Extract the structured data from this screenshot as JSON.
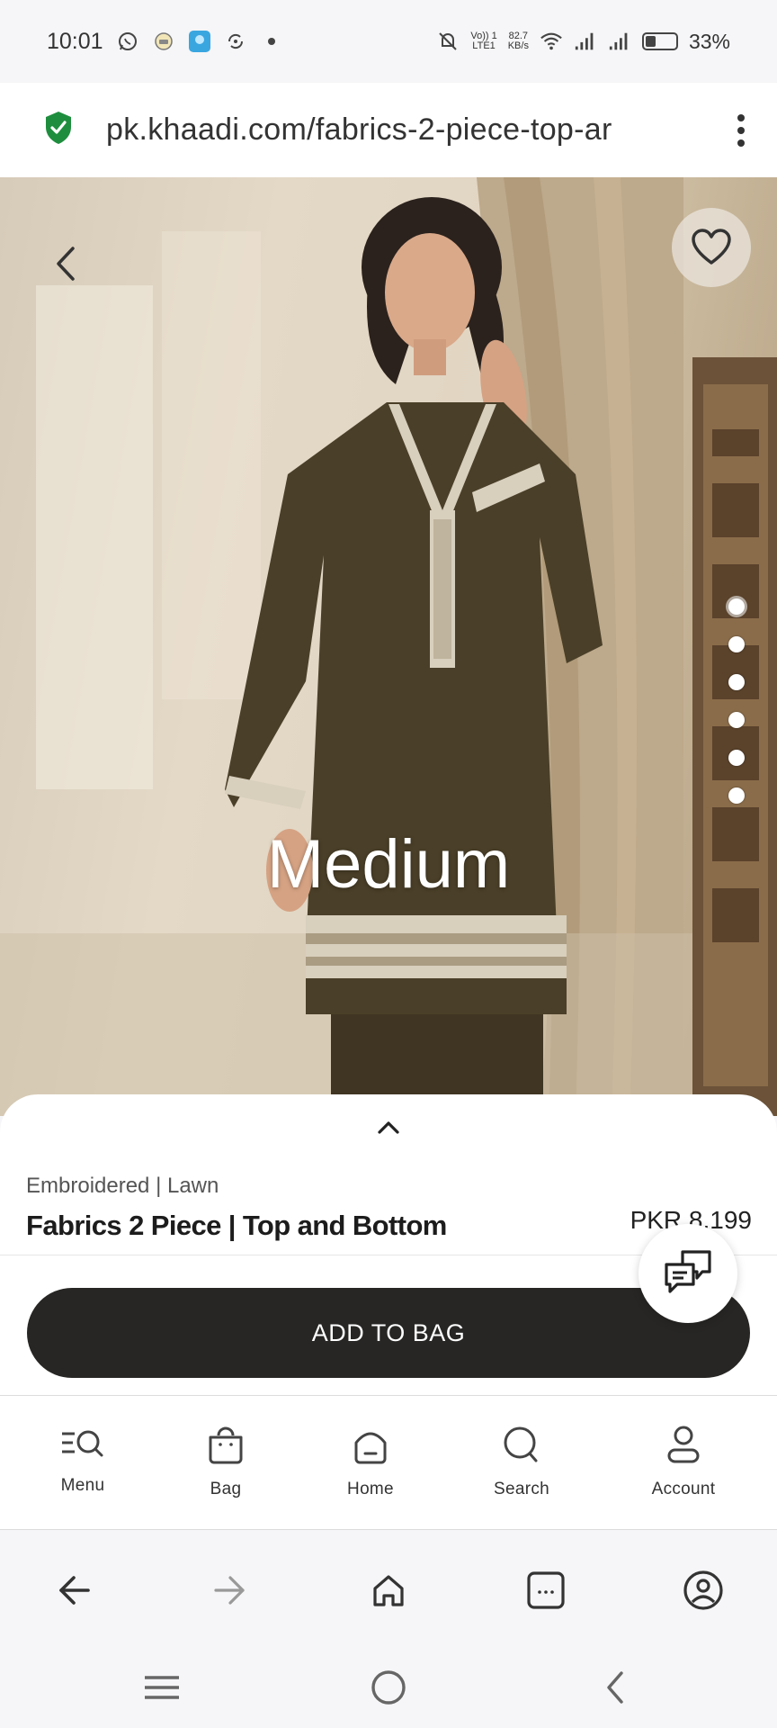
{
  "status_bar": {
    "time": "10:01",
    "network_speed": "82.7",
    "network_unit": "KB/s",
    "volte_top": "Vo)) 1",
    "volte_bottom": "LTE1",
    "battery_percent": "33%",
    "battery_level": 0.33
  },
  "browser": {
    "url": "pk.khaadi.com/fabrics-2-piece-top-ar"
  },
  "hero": {
    "overlay_label": "Medium",
    "slide_count": 6,
    "active_slide": 0
  },
  "product": {
    "category": "Embroidered | Lawn",
    "name": "Fabrics 2 Piece | Top and Bottom",
    "price": "PKR 8,199"
  },
  "cta": {
    "add_to_bag_label": "ADD TO BAG"
  },
  "app_nav": {
    "items": [
      {
        "label": "Menu",
        "icon": "menu-search-icon"
      },
      {
        "label": "Bag",
        "icon": "bag-icon"
      },
      {
        "label": "Home",
        "icon": "home-icon"
      },
      {
        "label": "Search",
        "icon": "search-icon"
      },
      {
        "label": "Account",
        "icon": "account-icon"
      }
    ]
  },
  "colors": {
    "primary_button": "#272624",
    "secure_badge": "#1e8e3e",
    "garment": "#4a3f28"
  }
}
